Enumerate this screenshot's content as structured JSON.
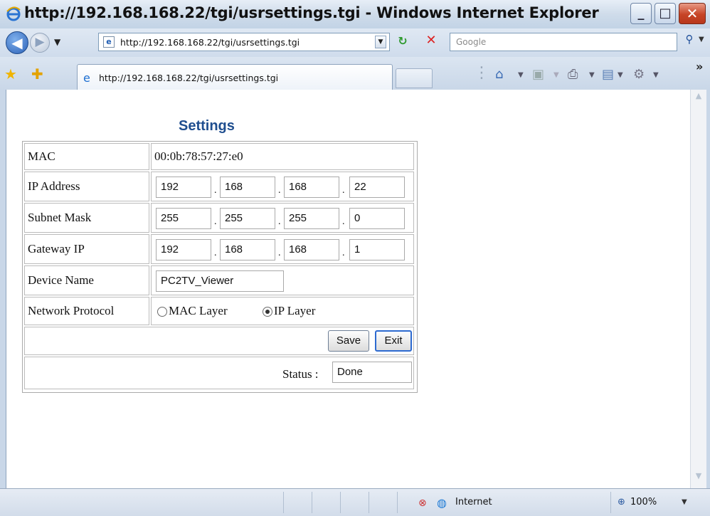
{
  "window": {
    "title": "http://192.168.168.22/tgi/usrsettings.tgi - Windows Internet Explorer",
    "min_glyph": "_",
    "max_glyph": "□",
    "close_glyph": "✕"
  },
  "address_bar": {
    "url": "http://192.168.168.22/tgi/usrsettings.tgi",
    "search_placeholder": "Google"
  },
  "tab": {
    "label": "http://192.168.168.22/tgi/usrsettings.tgi"
  },
  "page": {
    "title": "Settings",
    "rows": {
      "mac": {
        "label": "MAC",
        "value": "00:0b:78:57:27:e0"
      },
      "ip": {
        "label": "IP Address",
        "octets": [
          "192",
          "168",
          "168",
          "22"
        ]
      },
      "subnet": {
        "label": "Subnet Mask",
        "octets": [
          "255",
          "255",
          "255",
          "0"
        ]
      },
      "gateway": {
        "label": "Gateway IP",
        "octets": [
          "192",
          "168",
          "168",
          "1"
        ]
      },
      "device": {
        "label": "Device Name",
        "value": "PC2TV_Viewer"
      },
      "protocol": {
        "label": "Network Protocol",
        "options": [
          "MAC Layer",
          "IP Layer"
        ],
        "selected": "IP Layer"
      }
    },
    "buttons": {
      "save": "Save",
      "exit": "Exit"
    },
    "status": {
      "label": "Status :",
      "value": "Done"
    }
  },
  "status_bar": {
    "zone": "Internet",
    "zoom": "100%"
  },
  "colors": {
    "title_accent": "#1f4e8f",
    "exit_focus": "#2d6ad0"
  },
  "icons": [
    "ie-page-icon",
    "back-arrow-icon",
    "forward-arrow-icon",
    "refresh-icon",
    "stop-icon",
    "search-icon",
    "favorites-star-icon",
    "add-favorites-icon",
    "home-icon",
    "feeds-icon",
    "print-icon",
    "page-icon",
    "tools-gear-icon",
    "globe-icon",
    "zoom-icon"
  ]
}
